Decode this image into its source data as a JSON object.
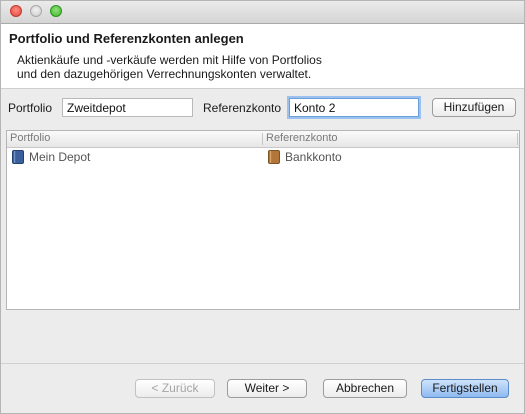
{
  "window": {
    "controls": {
      "close": "close-icon",
      "minimize": "minimize-icon",
      "maximize": "maximize-icon"
    }
  },
  "header": {
    "title": "Portfolio und Referenzkonten anlegen",
    "description_line1": "Aktienkäufe und -verkäufe werden mit Hilfe von Portfolios",
    "description_line2": "und den dazugehörigen Verrechnungskonten verwaltet."
  },
  "form": {
    "portfolio_label": "Portfolio",
    "portfolio_value": "Zweitdepot",
    "referenzkonto_label": "Referenzkonto",
    "referenzkonto_value": "Konto 2",
    "add_button": "Hinzufügen"
  },
  "table": {
    "columns": [
      "Portfolio",
      "Referenzkonto"
    ],
    "rows": [
      {
        "portfolio": "Mein Depot",
        "portfolio_icon": "portfolio-book-icon",
        "account": "Bankkonto",
        "account_icon": "account-book-icon"
      }
    ]
  },
  "footer": {
    "back_button": "< Zurück",
    "next_button": "Weiter >",
    "cancel_button": "Abbrechen",
    "finish_button": "Fertigstellen"
  },
  "colors": {
    "accent": "#6a9fdc",
    "default_button": "#8fbaf0",
    "portfolio_icon": "#3a5f9a",
    "account_icon": "#b0763a"
  }
}
